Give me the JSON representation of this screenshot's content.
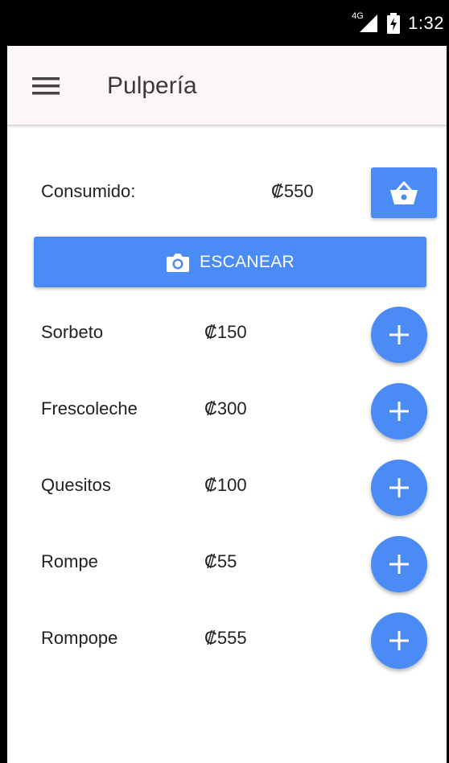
{
  "status_bar": {
    "network": "4G",
    "time": "1:32"
  },
  "app_bar": {
    "title": "Pulpería",
    "menu_icon": "menu-icon"
  },
  "summary": {
    "consumed_label": "Consumido:",
    "consumed_value": "₡550",
    "basket_icon": "shopping-basket-icon"
  },
  "scan": {
    "label": "ESCANEAR",
    "icon": "camera-icon"
  },
  "products": [
    {
      "name": "Sorbeto",
      "price": "₡150"
    },
    {
      "name": "Frescoleche",
      "price": "₡300"
    },
    {
      "name": "Quesitos",
      "price": "₡100"
    },
    {
      "name": "Rompe",
      "price": "₡55"
    },
    {
      "name": "Rompope",
      "price": "₡555"
    }
  ],
  "colors": {
    "accent": "#4b8bf5",
    "app_bar_bg": "#fcf6fb",
    "status_bar_bg": "#000000"
  }
}
